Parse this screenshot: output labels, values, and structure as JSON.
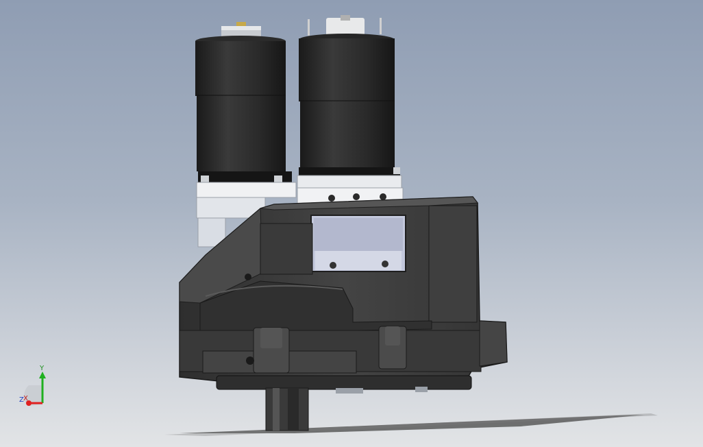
{
  "viewport": {
    "background_top": "#8f9db3",
    "background_bottom": "#e2e4e6"
  },
  "model": {
    "body_color": "#3c3c3c",
    "motor_color": "#262626",
    "bracket_color": "#dfe2e8",
    "window_color": "#c3c8dc"
  },
  "triad": {
    "x_label": "X",
    "y_label": "Y",
    "z_label": "Z",
    "x_color": "#e02020",
    "y_color": "#20b020",
    "z_color": "#3050ff"
  }
}
